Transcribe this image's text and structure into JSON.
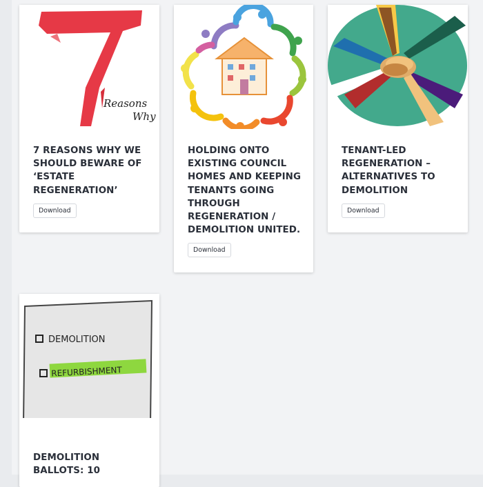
{
  "cards": [
    {
      "title": "7 REASONS WHY WE SHOULD BEWARE OF ‘ESTATE REGENERATION’",
      "download_label": "Download",
      "image": {
        "text_line1": "Reasons",
        "text_line2": "Why",
        "numeral": "7"
      }
    },
    {
      "title": "HOLDING ONTO EXISTING COUNCIL HOMES AND KEEPING TENANTS GOING THROUGH REGENERATION / DEMOLITION UNITED.",
      "download_label": "Download"
    },
    {
      "title": "TENANT-LED REGENERATION – ALTERNATIVES TO DEMOLITION",
      "download_label": "Download"
    },
    {
      "title": "DEMOLITION BALLOTS: 10",
      "image": {
        "option1": "DEMOLITION",
        "option2": "REFURBISHMENT"
      }
    }
  ],
  "colors": {
    "accent_red": "#e63946",
    "teal": "#43a98c",
    "marker_green": "#7ed321"
  }
}
